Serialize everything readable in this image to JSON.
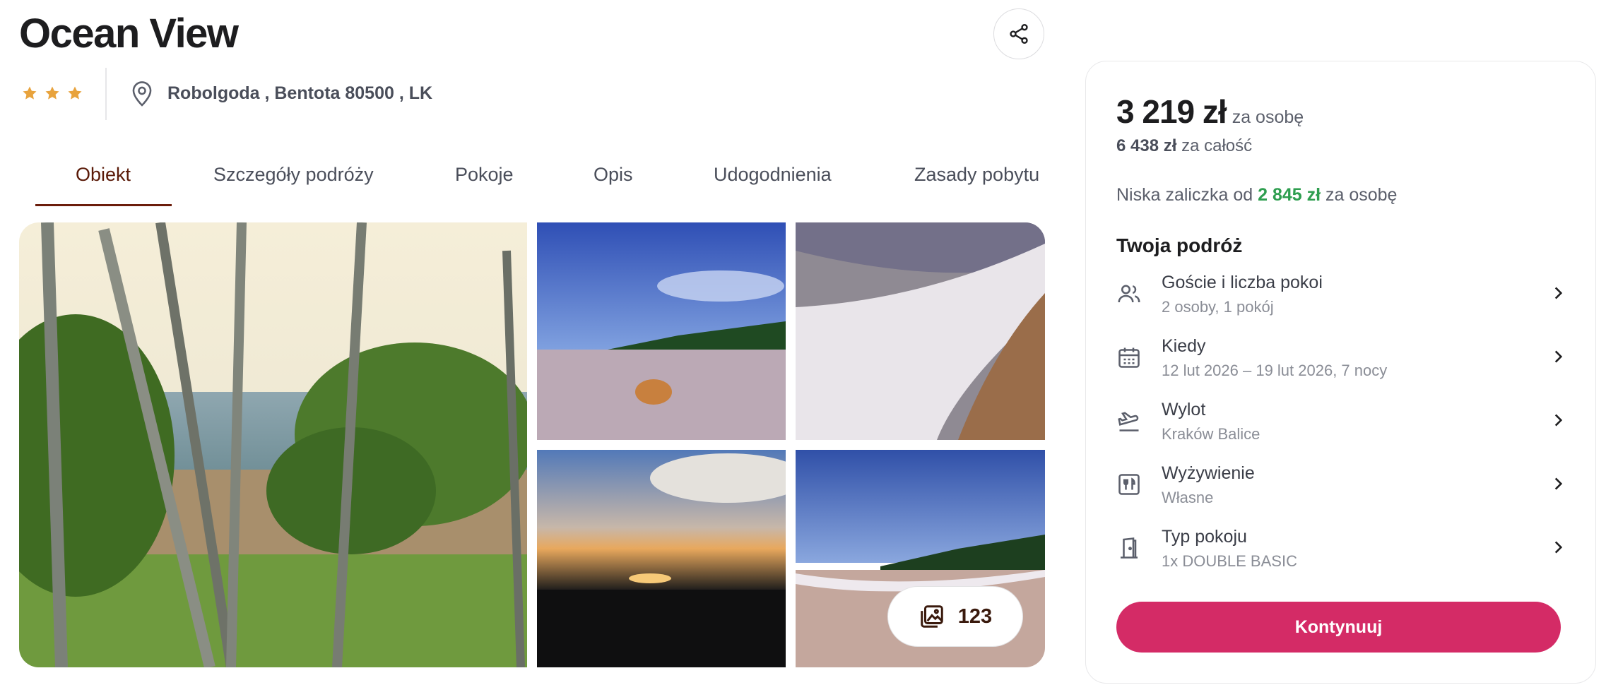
{
  "hotel": {
    "name": "Ocean View",
    "stars": 3,
    "location": "Robolgoda , Bentota 80500 , LK"
  },
  "tabs": [
    {
      "label": "Obiekt",
      "active": true
    },
    {
      "label": "Szczegóły podróży",
      "active": false
    },
    {
      "label": "Pokoje",
      "active": false
    },
    {
      "label": "Opis",
      "active": false
    },
    {
      "label": "Udogodnienia",
      "active": false
    },
    {
      "label": "Zasady pobytu",
      "active": false
    }
  ],
  "gallery": {
    "photo_count": "123"
  },
  "booking": {
    "price": "3 219 zł",
    "price_per": "za osobę",
    "total_amount": "6 438 zł",
    "total_suffix": "za całość",
    "deposit_prefix": "Niska zaliczka od",
    "deposit_amount": "2 845 zł",
    "deposit_suffix": "za osobę",
    "trip_title": "Twoja podróż",
    "rows": [
      {
        "icon": "guests-icon",
        "label": "Goście i liczba pokoi",
        "value": "2 osoby, 1 pokój"
      },
      {
        "icon": "calendar-icon",
        "label": "Kiedy",
        "value": "12 lut 2026 – 19 lut 2026, 7 nocy"
      },
      {
        "icon": "plane-departure-icon",
        "label": "Wylot",
        "value": "Kraków Balice"
      },
      {
        "icon": "meal-icon",
        "label": "Wyżywienie",
        "value": "Własne"
      },
      {
        "icon": "door-icon",
        "label": "Typ pokoju",
        "value": "1x DOUBLE BASIC"
      }
    ],
    "continue_label": "Kontynuuj"
  },
  "colors": {
    "accent": "#d42b66",
    "tab_active": "#6b1d0b",
    "star": "#e8a33d",
    "deposit": "#2e9e4f"
  }
}
